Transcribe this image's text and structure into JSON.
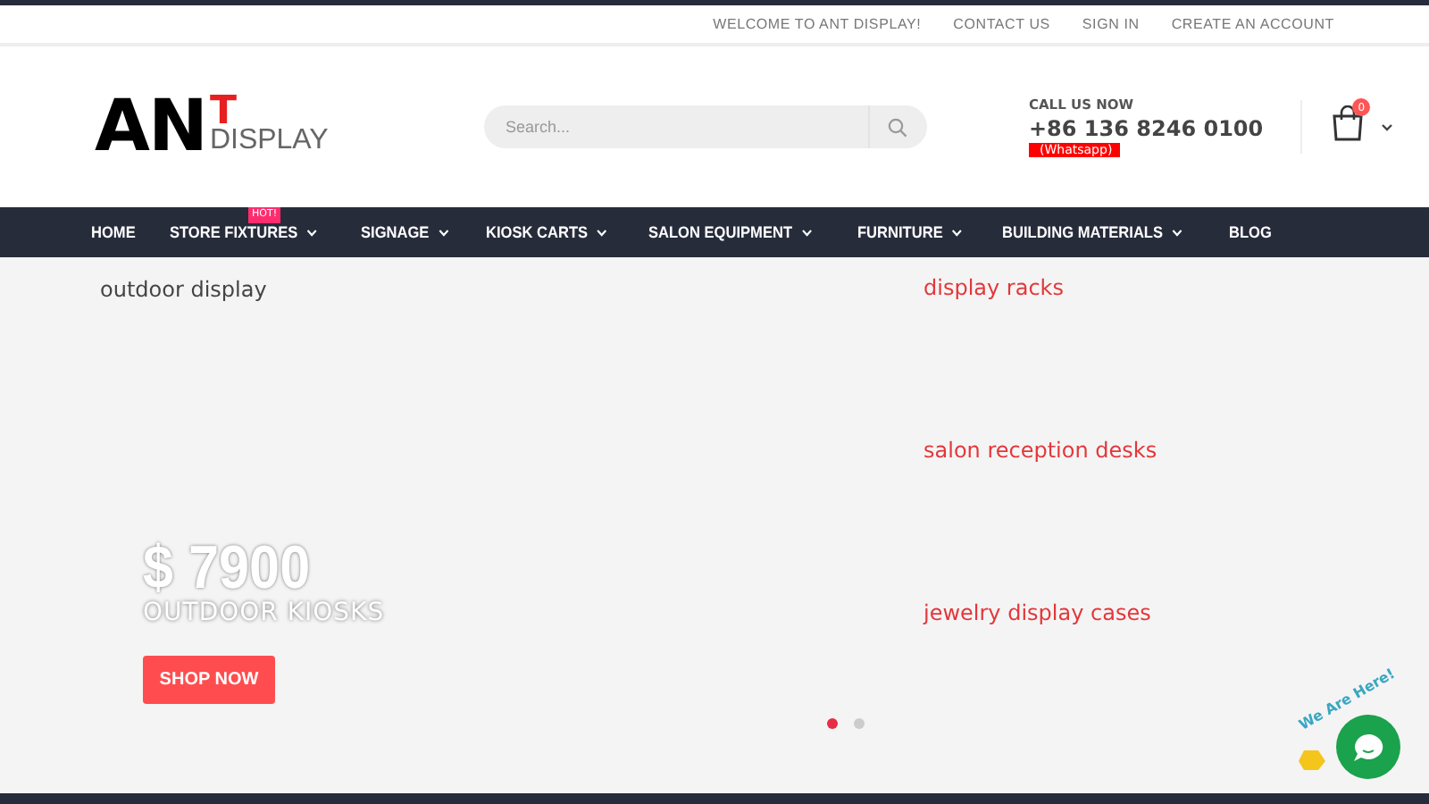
{
  "top_links": [
    "WELCOME TO ANT DISPLAY!",
    "CONTACT US",
    "SIGN IN",
    "CREATE AN ACCOUNT"
  ],
  "logo": {
    "main": "AN",
    "accent": "T",
    "sub": "DISPLAY"
  },
  "search": {
    "placeholder": "Search..."
  },
  "contact": {
    "label": "CALL US NOW",
    "phone": "+86 136 8246 0100",
    "tag": "(Whatsapp)"
  },
  "cart": {
    "count": "0"
  },
  "nav": [
    {
      "label": "HOME",
      "dropdown": false
    },
    {
      "label": "STORE FIXTURES",
      "dropdown": true,
      "badge": "HOT!"
    },
    {
      "label": "SIGNAGE",
      "dropdown": true
    },
    {
      "label": "KIOSK CARTS",
      "dropdown": true
    },
    {
      "label": "SALON EQUIPMENT",
      "dropdown": true
    },
    {
      "label": "FURNITURE",
      "dropdown": true
    },
    {
      "label": "BUILDING MATERIALS",
      "dropdown": true
    },
    {
      "label": "BLOG",
      "dropdown": false
    }
  ],
  "hero": {
    "left_link": "outdoor display",
    "price": "$ 7900",
    "subtitle": "OUTDOOR KIOSKS",
    "button": "SHOP NOW",
    "right_links": [
      "display racks",
      "salon reception desks",
      "jewelry display cases"
    ],
    "dots": [
      {
        "selected": true
      },
      {
        "selected": false
      }
    ]
  },
  "chat": {
    "greeting": "We Are Here!"
  }
}
